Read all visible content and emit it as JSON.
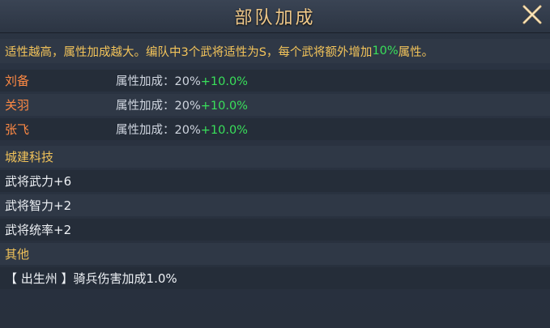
{
  "title": "部队加成",
  "description": {
    "prefix": "适性越高，属性加成越大。编队中3个武将适性为S，每个武将额外增加",
    "highlight": "10%",
    "suffix": "属性。"
  },
  "heroes": [
    {
      "name": "刘备",
      "label": "属性加成：20%",
      "bonus": "+10.0%"
    },
    {
      "name": "关羽",
      "label": "属性加成：20%",
      "bonus": "+10.0%"
    },
    {
      "name": "张飞",
      "label": "属性加成：20%",
      "bonus": "+10.0%"
    }
  ],
  "city_tech": {
    "header": "城建科技",
    "items": [
      "武将武力+6",
      "武将智力+2",
      "武将统率+2"
    ]
  },
  "other": {
    "header": "其他",
    "items": [
      "【 出生州 】骑兵伤害加成1.0%"
    ]
  },
  "colors": {
    "title": "#f0c98a",
    "hero_name": "#ff8a44",
    "section_header": "#f2c35a",
    "bonus": "#39e05a"
  },
  "icons": {
    "close": "close-icon"
  }
}
